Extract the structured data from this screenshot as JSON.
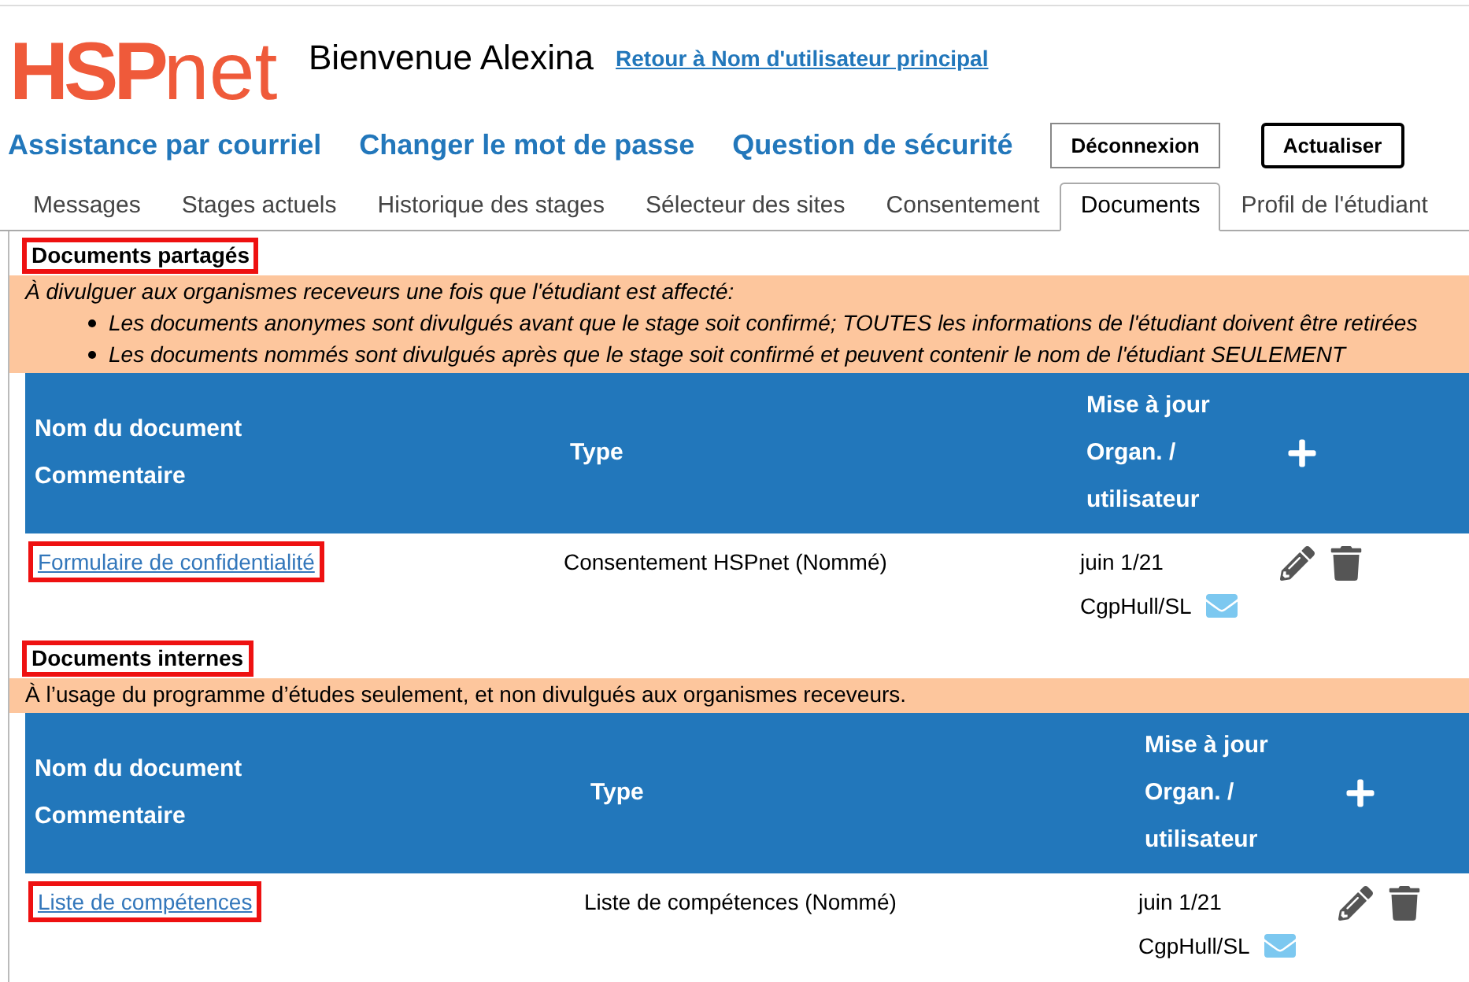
{
  "logo": {
    "bold": "HSP",
    "light": "net"
  },
  "welcome": "Bienvenue Alexina",
  "back_link": "Retour à Nom d'utilisateur principal",
  "nav_links": [
    "Assistance par courriel",
    "Changer le mot de passe",
    "Question de sécurité"
  ],
  "buttons": [
    {
      "label": "Déconnexion",
      "kind": "plain"
    },
    {
      "label": "Actualiser",
      "kind": "strong"
    }
  ],
  "tabs": [
    {
      "label": "Messages",
      "selected": false
    },
    {
      "label": "Stages actuels",
      "selected": false
    },
    {
      "label": "Historique des stages",
      "selected": false
    },
    {
      "label": "Sélecteur des sites",
      "selected": false
    },
    {
      "label": "Consentement",
      "selected": false
    },
    {
      "label": "Documents",
      "selected": true
    },
    {
      "label": "Profil de l'étudiant",
      "selected": false
    }
  ],
  "sections": [
    {
      "title": "Documents partagés",
      "highlighted": true,
      "description": "À divulguer aux organismes receveurs une fois que l'étudiant est affecté:",
      "italic": true,
      "bullets": [
        "Les documents anonymes sont divulgués avant que le stage soit confirmé; TOUTES les informations de l'étudiant doivent être retirées",
        "Les documents nommés sont divulgués après que le stage soit confirmé et peuvent contenir le nom de l'étudiant SEULEMENT"
      ],
      "table": {
        "columns": [
          [
            "Nom du document",
            "Commentaire"
          ],
          [
            "Type"
          ],
          [
            "Mise à jour",
            "Organ. /",
            "utilisateur"
          ]
        ],
        "rows": [
          {
            "name": "Formulaire de confidentialité",
            "highlighted": true,
            "type": "Consentement HSPnet (Nommé)",
            "date": "juin 1/21",
            "user": "CgpHull/SL"
          }
        ]
      }
    },
    {
      "title": "Documents internes",
      "highlighted": true,
      "description": "À l’usage du programme d’études seulement, et non divulgués aux organismes receveurs.",
      "italic": false,
      "table": {
        "columns": [
          [
            "Nom du document",
            "Commentaire"
          ],
          [
            "Type"
          ],
          [
            "Mise à jour",
            "Organ. /",
            "utilisateur"
          ]
        ],
        "rows": [
          {
            "name": "Liste de compétences",
            "highlighted": true,
            "type": "Liste de compétences (Nommé)",
            "date": "juin 1/21",
            "user": "CgpHull/SL"
          }
        ]
      }
    }
  ]
}
